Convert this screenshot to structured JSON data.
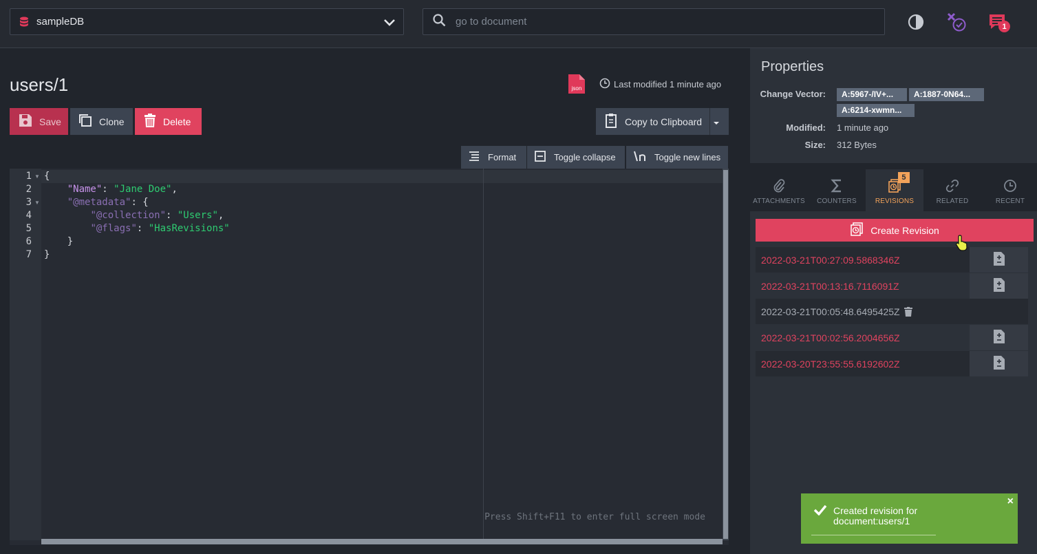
{
  "topbar": {
    "database": "sampleDB",
    "search_placeholder": "go to document",
    "notifications_count": "1"
  },
  "document": {
    "title": "users/1",
    "last_modified": "Last modified 1 minute ago"
  },
  "actions": {
    "save": "Save",
    "clone": "Clone",
    "delete": "Delete",
    "copy": "Copy to Clipboard"
  },
  "editor_tools": {
    "format": "Format",
    "toggle_collapse": "Toggle collapse",
    "toggle_new_lines": "Toggle new lines"
  },
  "editor": {
    "line_numbers": [
      "1",
      "2",
      "3",
      "4",
      "5",
      "6",
      "7"
    ],
    "fullscreen_hint": "Press Shift+F11 to enter full screen mode"
  },
  "properties": {
    "title": "Properties",
    "change_vector_label": "Change Vector:",
    "change_vectors": [
      "A:5967-/IV+...",
      "A:1887-0N64...",
      "A:6214-xwmn..."
    ],
    "modified_label": "Modified:",
    "modified_value": "1 minute ago",
    "size_label": "Size:",
    "size_value": "312 Bytes"
  },
  "tabs": [
    {
      "label": "ATTACHMENTS"
    },
    {
      "label": "COUNTERS"
    },
    {
      "label": "REVISIONS",
      "badge": "5"
    },
    {
      "label": "RELATED"
    },
    {
      "label": "RECENT"
    }
  ],
  "revisions": {
    "create_label": "Create Revision",
    "items": [
      "2022-03-21T00:27:09.5868346Z",
      "2022-03-21T00:13:16.7116091Z",
      "2022-03-21T00:05:48.6495425Z",
      "2022-03-21T00:02:56.2004656Z",
      "2022-03-20T23:55:55.6192602Z"
    ]
  },
  "toast": {
    "message": "Created revision for document:users/1",
    "close": "×"
  },
  "colors": {
    "accent": "#e0435f",
    "revisions_accent": "#f3a35a",
    "toast": "#6aa83d"
  }
}
